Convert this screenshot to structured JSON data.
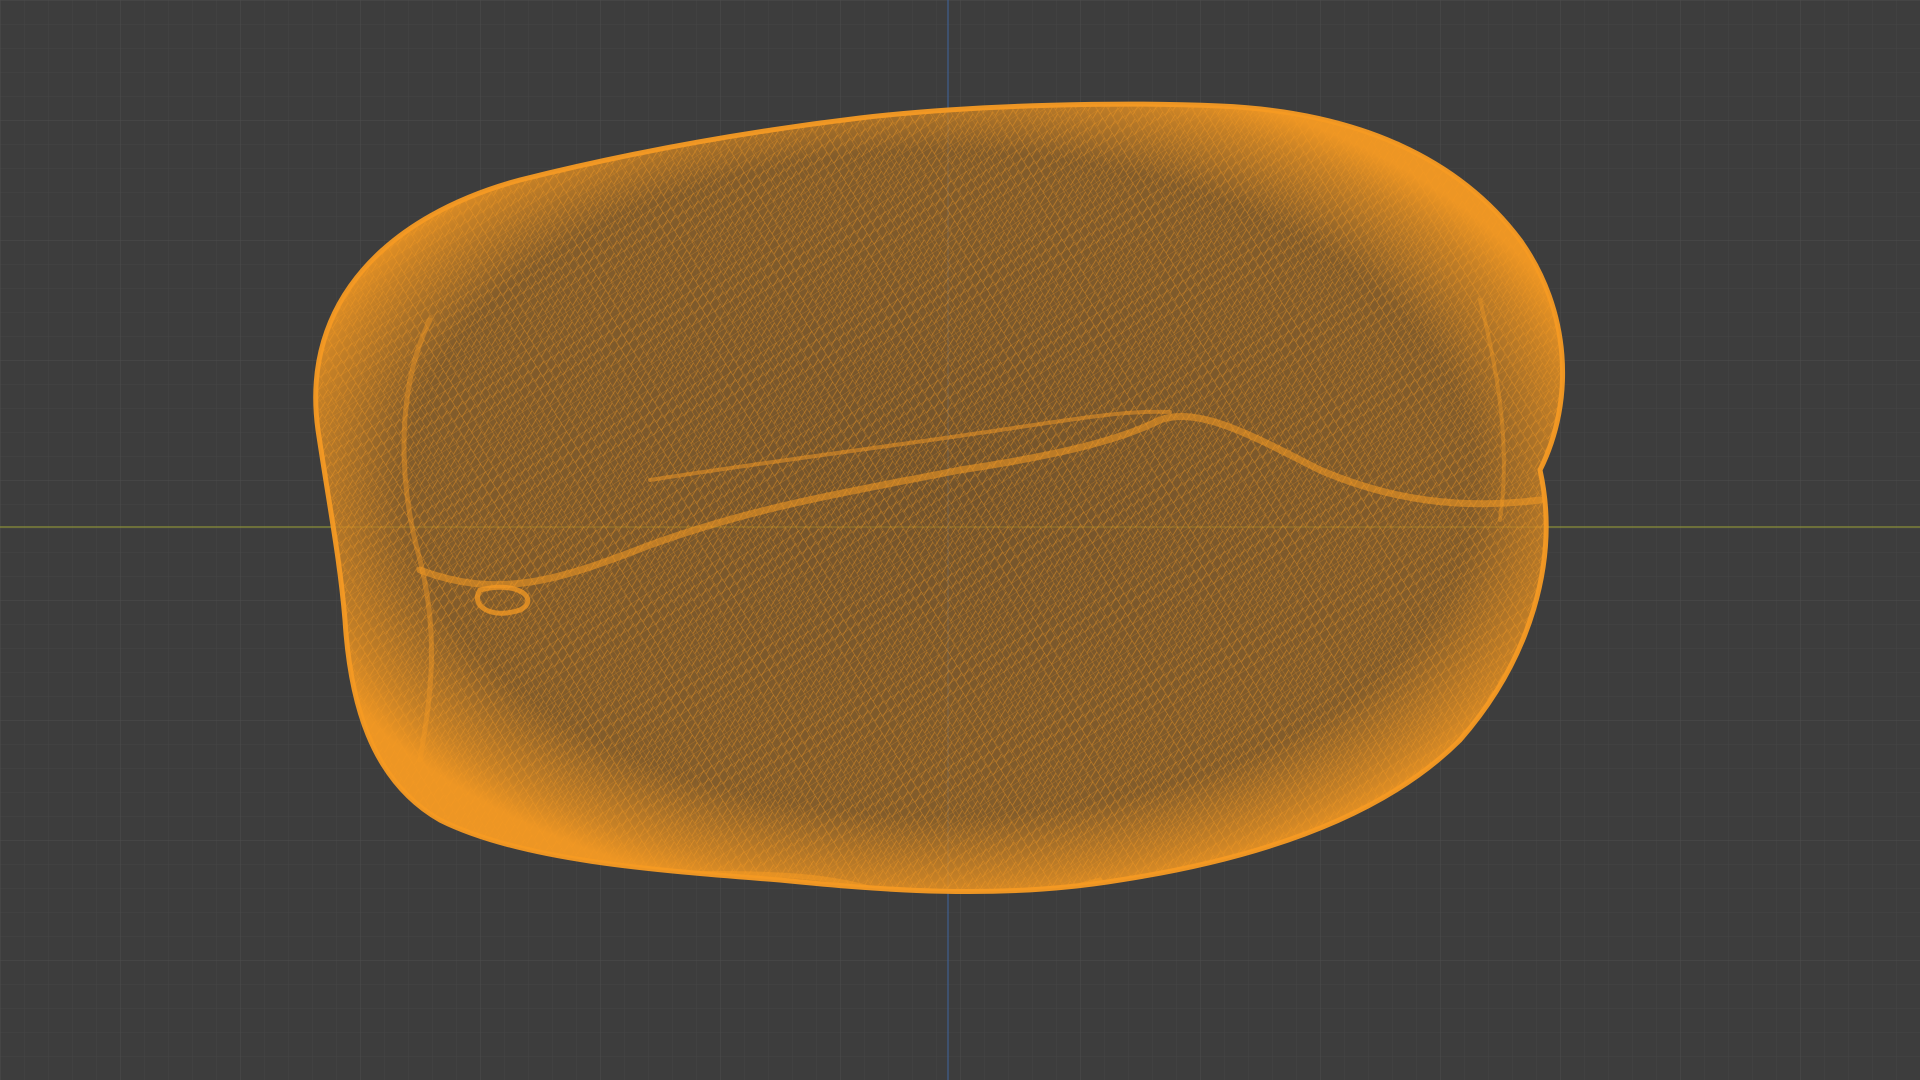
{
  "app": {
    "view": "3d-viewport",
    "shading_mode": "wireframe"
  },
  "viewport": {
    "background_color": "#3d3d3d",
    "grid_minor_color": "#454545",
    "grid_major_color": "#4d4d4d",
    "axis_x_color": "#8a8f3a",
    "axis_y_color": "#3f5f8f"
  },
  "mesh": {
    "name": "",
    "selected": true,
    "wire_color": "#f59a23",
    "wire_dim_color": "#a8661c"
  }
}
